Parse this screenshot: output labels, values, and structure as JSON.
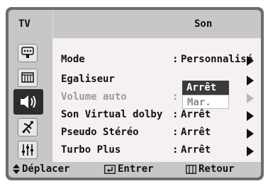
{
  "header": {
    "tv_label": "TV",
    "title": "Son"
  },
  "sidebar": {
    "items": [
      {
        "icon": "input-icon",
        "active": false
      },
      {
        "icon": "picture-icon",
        "active": false
      },
      {
        "icon": "speaker-icon",
        "active": true
      },
      {
        "icon": "channel-antenna-icon",
        "active": false
      },
      {
        "icon": "setup-sliders-icon",
        "active": false
      }
    ]
  },
  "menu": {
    "rows": [
      {
        "label": "Mode",
        "value": "Personnalisé",
        "colon": ":",
        "enabled": true
      },
      {
        "label": "Egaliseur",
        "value": "",
        "colon": "",
        "enabled": true
      },
      {
        "label": "Volume auto",
        "value": "",
        "colon": ":",
        "enabled": false
      },
      {
        "label": "Son Virtual dolby",
        "value": "Arrêt",
        "colon": ":",
        "enabled": true
      },
      {
        "label": "Pseudo Stéréo",
        "value": "Arrêt",
        "colon": ":",
        "enabled": true
      },
      {
        "label": "Turbo Plus",
        "value": "Arrêt",
        "colon": ":",
        "enabled": true
      }
    ],
    "dropdown": {
      "selected": "Arrêt",
      "other": "Mar."
    }
  },
  "footer": {
    "move": "Déplacer",
    "enter": "Entrer",
    "back": "Retour"
  },
  "colors": {
    "frame": "#6d6d6d",
    "panel": "#f4f0f4",
    "bar": "#c7c7c7",
    "active": "#2c2c2c"
  }
}
